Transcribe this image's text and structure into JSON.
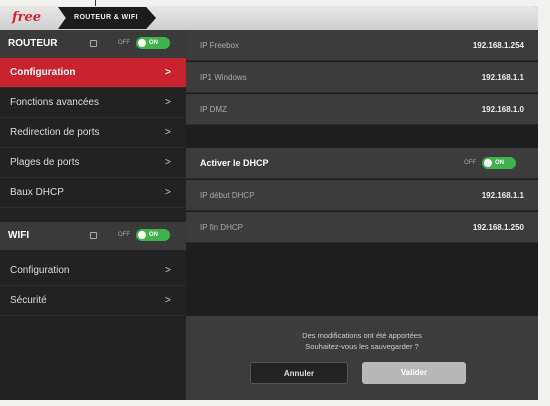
{
  "header": {
    "logo": "free",
    "breadcrumb": "ROUTEUR & WIFI"
  },
  "sidebar": {
    "routeur": {
      "title": "ROUTEUR",
      "toggle_off": "OFF",
      "toggle_on": "ON"
    },
    "routeur_items": [
      {
        "label": "Configuration",
        "active": true
      },
      {
        "label": "Fonctions avancées",
        "active": false
      },
      {
        "label": "Redirection de ports",
        "active": false
      },
      {
        "label": "Plages de ports",
        "active": false
      },
      {
        "label": "Baux DHCP",
        "active": false
      }
    ],
    "wifi": {
      "title": "WIFI",
      "toggle_off": "OFF",
      "toggle_on": "ON"
    },
    "wifi_items": [
      {
        "label": "Configuration"
      },
      {
        "label": "Sécurité"
      }
    ]
  },
  "main": {
    "ip_rows": [
      {
        "key": "IP Freebox",
        "value": "192.168.1.254"
      },
      {
        "key": "IP1 Windows",
        "value": "192.168.1.1"
      },
      {
        "key": "IP DMZ",
        "value": "192.168.1.0"
      }
    ],
    "dhcp": {
      "title": "Activer le DHCP",
      "toggle_off": "OFF",
      "toggle_on": "ON",
      "rows": [
        {
          "key": "IP début DHCP",
          "value": "192.168.1.1"
        },
        {
          "key": "IP fin DHCP",
          "value": "192.168.1.250"
        }
      ]
    }
  },
  "save": {
    "line1": "Des modifications ont été apportées",
    "line2": "Souhaitez-vous les sauvegarder ?",
    "cancel": "Annuler",
    "ok": "Valider"
  },
  "colors": {
    "accent_red": "#c8232e",
    "toggle_green": "#3fb34a",
    "panel_dark": "#222222",
    "row_gray": "#3c3c3c"
  }
}
